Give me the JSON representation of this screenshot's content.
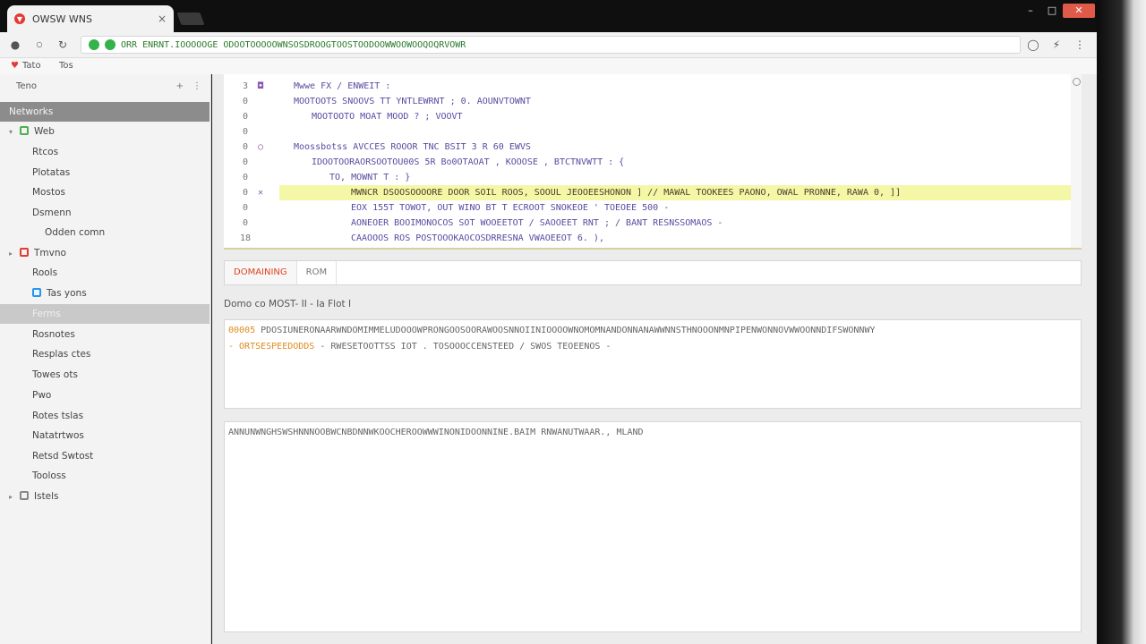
{
  "browser": {
    "tab_title": "OWSW WNS",
    "tab_close": "×",
    "window_controls": [
      "–",
      "□",
      "✕"
    ],
    "url": "ORR ENRNT.IOOOOOGE ODOOTOOOOOWNSOSDROOGTOOSTOODOOWWOOWOOQOQRVOWR",
    "nav_right_icons": [
      "○",
      "◯",
      "⚡",
      "⋮"
    ]
  },
  "bookmarks": [
    {
      "label": "Tato"
    },
    {
      "label": "Tos"
    }
  ],
  "sidebar": {
    "header_title": "Teno",
    "header_icons": [
      "+",
      "⋮"
    ],
    "items": [
      {
        "label": "Networks",
        "level": 0,
        "state": "selected"
      },
      {
        "label": "Web",
        "level": 0,
        "arrow": "▾",
        "icon_color": "#4caf50"
      },
      {
        "label": "Rtcos",
        "level": 1
      },
      {
        "label": "Plotatas",
        "level": 1
      },
      {
        "label": "Mostos",
        "level": 1
      },
      {
        "label": "Dsmenn",
        "level": 1
      },
      {
        "label": "Odden comn",
        "level": 2
      },
      {
        "label": "Tmvno",
        "level": 0,
        "arrow": "▸",
        "icon_color": "#e53935"
      },
      {
        "label": "Rools",
        "level": 1
      },
      {
        "label": "Tas yons",
        "level": 1,
        "icon_color": "#2196f3"
      },
      {
        "label": "Ferms",
        "level": 1,
        "state": "selected-light"
      },
      {
        "label": "Rosnotes",
        "level": 1
      },
      {
        "label": "Resplas ctes",
        "level": 1
      },
      {
        "label": "Towes ots",
        "level": 1
      },
      {
        "label": "Pwo",
        "level": 1
      },
      {
        "label": "Rotes tslas",
        "level": 1
      },
      {
        "label": "Natatrtwos",
        "level": 1
      },
      {
        "label": "Retsd Swtost",
        "level": 1
      },
      {
        "label": "Tooloss",
        "level": 1
      },
      {
        "label": "Istels",
        "level": 0,
        "arrow": "▸",
        "icon_color": "#888888"
      }
    ]
  },
  "editor": {
    "lines": [
      {
        "num": "3",
        "mark": "◘",
        "indent": 0,
        "text": "Mwwe FX / ENWEIT :"
      },
      {
        "num": "0",
        "mark": "",
        "indent": 0,
        "text": "MOOTOOTS SNOOVS TT  YNTLEWRNT ; 0. AOUNVTOWNT"
      },
      {
        "num": "0",
        "mark": "",
        "indent": 1,
        "text": "MOOTOOTO  MOAT  MOOD ? ; VOOVT"
      },
      {
        "num": "0",
        "mark": "",
        "indent": 0,
        "text": ""
      },
      {
        "num": "0",
        "mark": "○",
        "indent": 0,
        "text": "Moossbotss AVCCES ROOOR TNC BSIT 3 R 60   EWVS"
      },
      {
        "num": "0",
        "mark": "",
        "indent": 1,
        "text": "IDOOTOORAORSOOTOU00S 5R  Bo0OTAOAT ,  KOOOSE , BTCTNVWTT : {"
      },
      {
        "num": "0",
        "mark": "",
        "indent": 2,
        "text": "TO,  MOWNT T  :  }"
      },
      {
        "num": "0",
        "mark": "✕",
        "indent": 3,
        "text": "MWNCR  DSOOSOOOORE  DOOR SOIL ROOS, SOOUL JEOOEESHONON ] // MAWAL TOOKEES PAONO,  OWAL PRONNE,  RAWA 0, ]]",
        "highlight": true
      },
      {
        "num": "0",
        "mark": "",
        "indent": 3,
        "text": "EOX 155T TOWOT, OUT WINO BT T ECROOT SNOKEOE  ' TOEOEE 500 -"
      },
      {
        "num": "0",
        "mark": "",
        "indent": 3,
        "text": "AONEOER BOOIMONOCOS SOT WOOEETOT  / SAOOEET RNT ;  /  BANT RESNSSOMAOS -"
      },
      {
        "num": "18",
        "mark": "",
        "indent": 3,
        "text": "CAAOOOS ROS  POSTOOOKAOCOSDRRESNA  VWAOEEOT 6. ),"
      }
    ]
  },
  "panel_tabs": [
    {
      "label": "DOMAINING",
      "active": true
    },
    {
      "label": "ROM",
      "active": false
    }
  ],
  "section_label": "Domo co MOST- II - Ia Flot  I",
  "output_box_1": {
    "line1_prefix": "00005",
    "line1_text": "PDOSIUNERONAARWNDOMIMMELUDOOOWPRONGOOSOORAWOOSNNOIINIOOOOWNOMOMNANDONNANAWWNNSTHNOOONMNPIPENWONNOVWWOONNDIFSWONNWY",
    "line2_prefix": "- ORTSESPEEDODDS",
    "line2_text": "- RWESETOOTTSS  IOT . TOSOOOCCENSTEED  /  SWOS  TEOEENOS -"
  },
  "output_box_2": {
    "line1": "ANNUNWNGHSWSHNNNOOBWCNBDNNWKOOCHEROOWWWINONIDOONNINE.BAIM RNWANUTWAAR., MLAND"
  }
}
